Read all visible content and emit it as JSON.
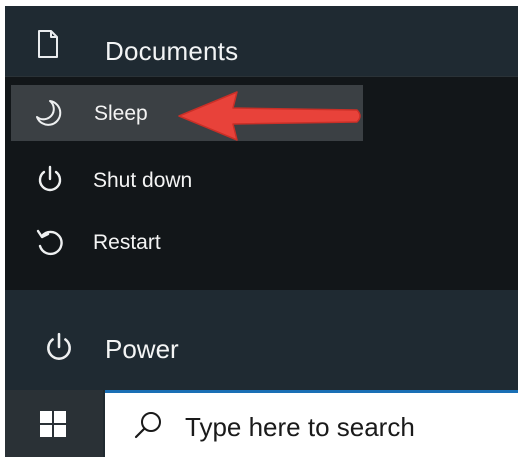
{
  "start_menu": {
    "documents_label": "Documents",
    "power_label": "Power",
    "power_menu": [
      {
        "label": "Sleep",
        "icon": "moon-icon",
        "highlighted": true
      },
      {
        "label": "Shut down",
        "icon": "power-icon"
      },
      {
        "label": "Restart",
        "icon": "restart-icon"
      }
    ]
  },
  "taskbar": {
    "start_icon": "windows-logo-icon",
    "search_placeholder": "Type here to search",
    "search_icon": "search-icon"
  },
  "annotation": {
    "arrow_color": "#e8423a",
    "points_to": "Sleep"
  },
  "colors": {
    "menu_background": "#1f2a32",
    "flyout_background": "#121619",
    "highlight": "#3b4044",
    "search_accent": "#1a6fb5"
  }
}
